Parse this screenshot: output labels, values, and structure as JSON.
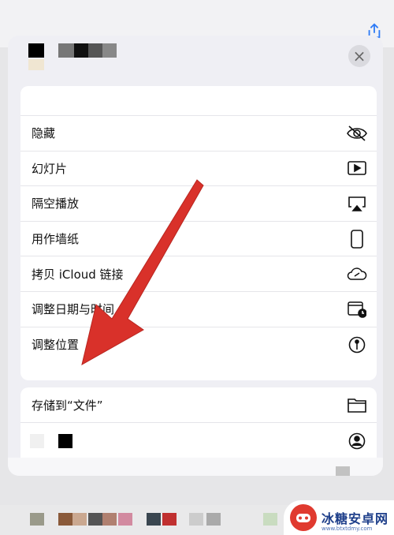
{
  "sheet": {
    "close_label": "×",
    "menu_items": [
      {
        "label": "隐藏",
        "icon": "eye-slash-icon"
      },
      {
        "label": "幻灯片",
        "icon": "play-icon"
      },
      {
        "label": "隔空播放",
        "icon": "airplay-icon"
      },
      {
        "label": "用作墙纸",
        "icon": "phone-icon"
      },
      {
        "label": "拷贝 iCloud 链接",
        "icon": "cloud-link-icon"
      },
      {
        "label": "调整日期与时间",
        "icon": "calendar-clock-icon"
      },
      {
        "label": "调整位置",
        "icon": "location-pin-icon"
      }
    ],
    "save_to_files": {
      "label": "存储到“文件”",
      "icon": "folder-icon"
    }
  },
  "watermark": {
    "text": "冰糖安卓网",
    "url": "www.btxtdmy.com"
  },
  "colors": {
    "accent": "#2f7cf6",
    "arrow": "#d9312a"
  }
}
